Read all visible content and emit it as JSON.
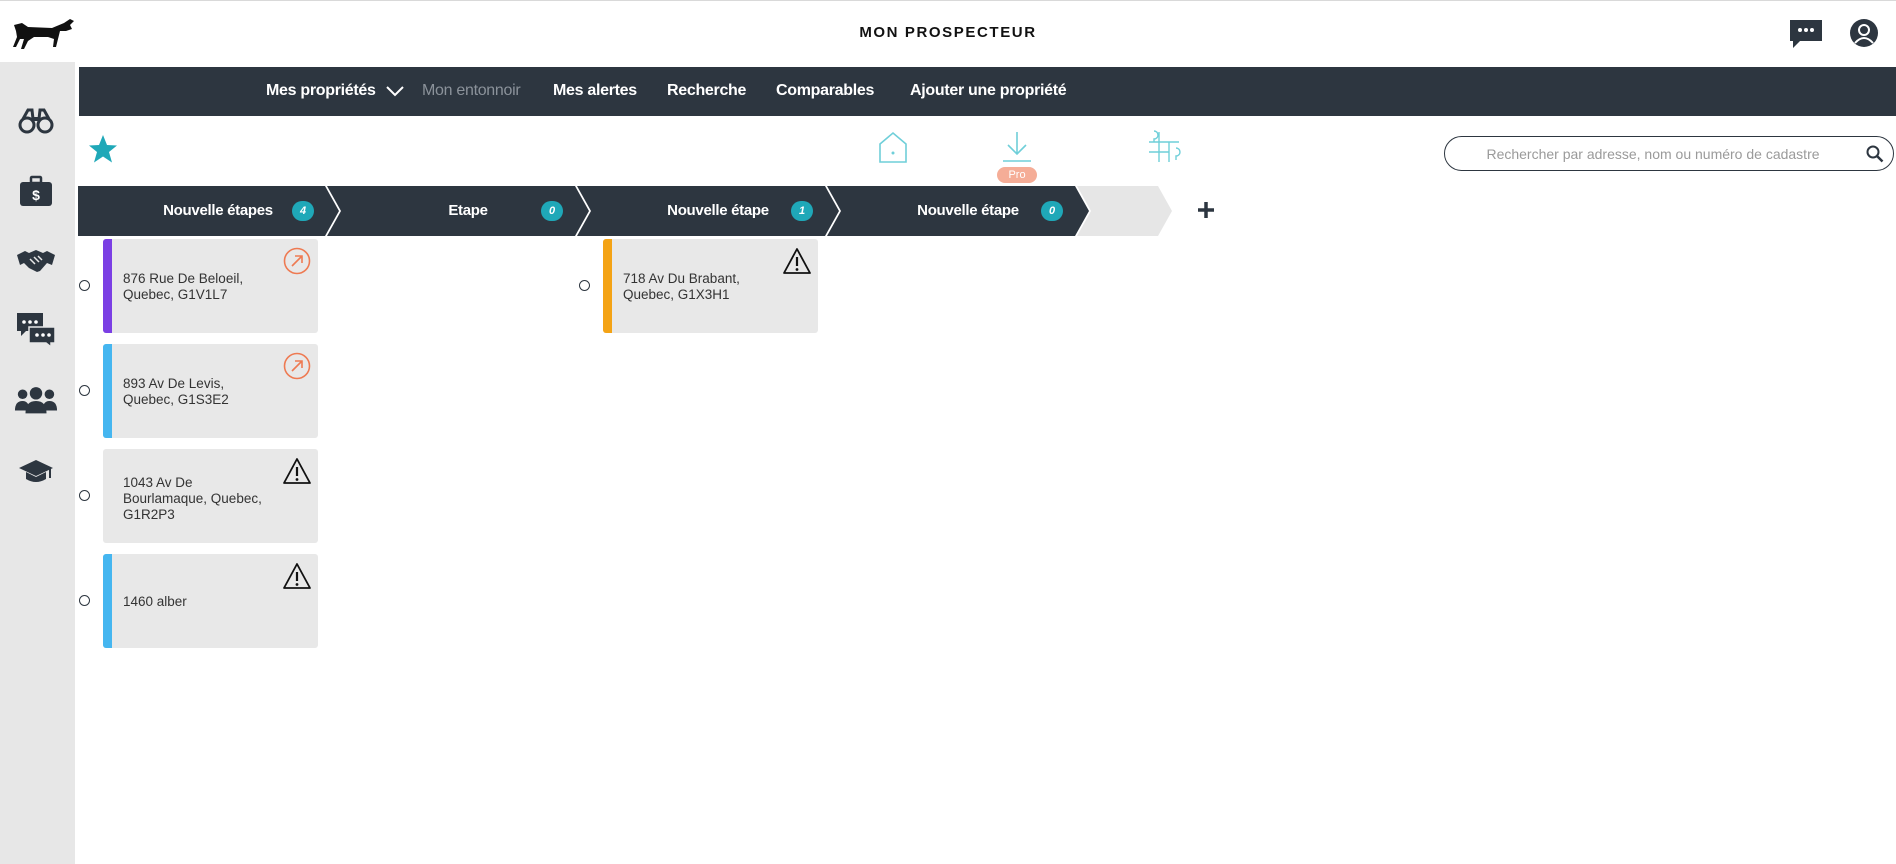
{
  "header": {
    "app_title": "MON PROSPECTEUR",
    "logo": "pointer-dog-logo",
    "chat_icon": "chat-bubble-icon",
    "user_icon": "user-icon"
  },
  "sidebar": {
    "items": [
      {
        "icon": "binoculars-icon"
      },
      {
        "icon": "briefcase-dollar-icon"
      },
      {
        "icon": "handshake-icon"
      },
      {
        "icon": "chat-bubbles-icon"
      },
      {
        "icon": "users-icon"
      },
      {
        "icon": "graduation-cap-icon"
      }
    ]
  },
  "nav": {
    "items": [
      {
        "label": "Mes propriétés",
        "has_dropdown": true
      },
      {
        "label": "Mon entonnoir",
        "active": true
      },
      {
        "label": "Mes alertes"
      },
      {
        "label": "Recherche"
      },
      {
        "label": "Comparables"
      },
      {
        "label": "Ajouter une propriété"
      }
    ]
  },
  "toolbar": {
    "favorite_icon": "star-icon",
    "tools": [
      "house-tag-icon",
      "download-icon",
      "map-route-icon"
    ],
    "pro_badge": "Pro",
    "search_placeholder": "Rechercher par adresse, nom ou numéro de cadastre"
  },
  "stages": [
    {
      "label": "Nouvelle étapes",
      "count": "4"
    },
    {
      "label": "Etape",
      "count": "0"
    },
    {
      "label": "Nouvelle étape",
      "count": "1"
    },
    {
      "label": "Nouvelle étape",
      "count": "0"
    }
  ],
  "cards": [
    {
      "stage": 0,
      "address": "876 Rue De Beloeil, Quebec, G1V1L7",
      "strip_color": "#7b3fe4",
      "corner_icon": "arrow-up-right-circle-icon"
    },
    {
      "stage": 0,
      "address": "893 Av De Levis, Quebec, G1S3E2",
      "strip_color": "#45b6f0",
      "corner_icon": "arrow-up-right-circle-icon"
    },
    {
      "stage": 0,
      "address": "1043 Av De Bourlamaque, Quebec, G1R2P3",
      "strip_color": "",
      "corner_icon": "warning-triangle-icon"
    },
    {
      "stage": 0,
      "address": "1460 alber",
      "strip_color": "#45b6f0",
      "corner_icon": "warning-triangle-icon"
    },
    {
      "stage": 2,
      "address": "718 Av Du Brabant, Quebec, G1X3H1",
      "strip_color": "#f4a315",
      "corner_icon": "warning-triangle-icon"
    }
  ],
  "colors": {
    "dark": "#2d3640",
    "teal": "#1fa8b8",
    "sidebar_bg": "#e7e7e7",
    "card_bg": "#e8e8e8",
    "orange_icon": "#ee7a52",
    "pro_badge": "#f5ad97"
  }
}
